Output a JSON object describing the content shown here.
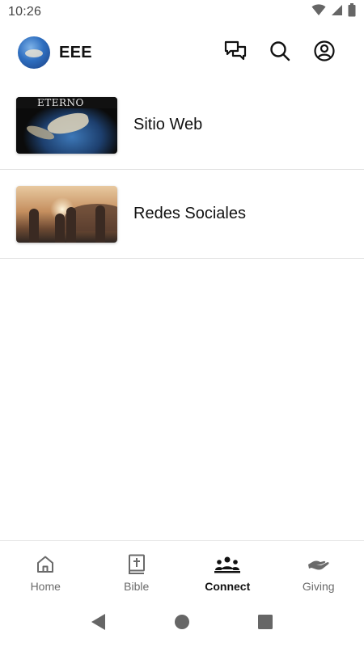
{
  "status_bar": {
    "time": "10:26",
    "icons": [
      "wifi-icon",
      "signal-icon",
      "battery-icon"
    ]
  },
  "header": {
    "app_name": "EEE",
    "actions": [
      "chat-icon",
      "search-icon",
      "account-icon"
    ]
  },
  "list": [
    {
      "label": "Sitio Web",
      "thumbnail_text": "ETERNO"
    },
    {
      "label": "Redes Sociales"
    }
  ],
  "bottom_nav": [
    {
      "label": "Home",
      "icon": "home-icon",
      "active": false
    },
    {
      "label": "Bible",
      "icon": "bible-icon",
      "active": false
    },
    {
      "label": "Connect",
      "icon": "connect-icon",
      "active": true
    },
    {
      "label": "Giving",
      "icon": "giving-icon",
      "active": false
    }
  ],
  "colors": {
    "text": "#111111",
    "muted": "#6a6a6a",
    "divider": "#e3e3e3",
    "system_icons": "#666666"
  }
}
